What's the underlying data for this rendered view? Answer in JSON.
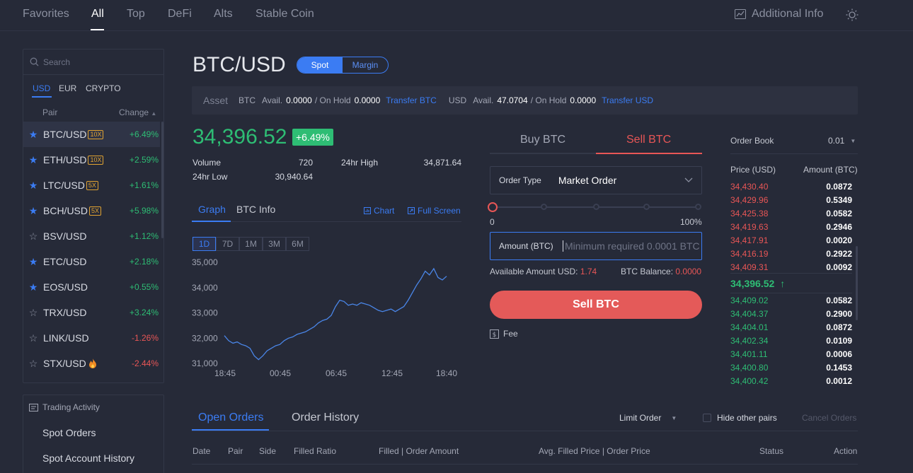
{
  "topnav": {
    "tabs": [
      "Favorites",
      "All",
      "Top",
      "DeFi",
      "Alts",
      "Stable Coin"
    ],
    "active": "All",
    "additional_info": "Additional Info"
  },
  "sidebar": {
    "search_placeholder": "Search",
    "currencies": [
      "USD",
      "EUR",
      "CRYPTO"
    ],
    "active_currency": "USD",
    "col_pair": "Pair",
    "col_change": "Change",
    "pairs": [
      {
        "name": "BTC/USD",
        "leverage": "10X",
        "change": "+6.49%",
        "starred": true
      },
      {
        "name": "ETH/USD",
        "leverage": "10X",
        "change": "+2.59%",
        "starred": true
      },
      {
        "name": "LTC/USD",
        "leverage": "5X",
        "change": "+1.61%",
        "starred": true
      },
      {
        "name": "BCH/USD",
        "leverage": "5X",
        "change": "+5.98%",
        "starred": true
      },
      {
        "name": "BSV/USD",
        "leverage": "",
        "change": "+1.12%",
        "starred": false
      },
      {
        "name": "ETC/USD",
        "leverage": "",
        "change": "+2.18%",
        "starred": true
      },
      {
        "name": "EOS/USD",
        "leverage": "",
        "change": "+0.55%",
        "starred": true
      },
      {
        "name": "TRX/USD",
        "leverage": "",
        "change": "+3.24%",
        "starred": false
      },
      {
        "name": "LINK/USD",
        "leverage": "",
        "change": "-1.26%",
        "starred": false
      },
      {
        "name": "STX/USD",
        "leverage": "",
        "change": "-2.44%",
        "starred": false
      }
    ]
  },
  "activity": {
    "title": "Trading Activity",
    "items": [
      "Spot Orders",
      "Spot Account History"
    ]
  },
  "header": {
    "pair": "BTC/USD",
    "spot": "Spot",
    "margin": "Margin"
  },
  "assets": {
    "label": "Asset",
    "btc_cur": "BTC",
    "btc_avail_label": "Avail.",
    "btc_avail": "0.0000",
    "btc_hold_label": "/ On Hold",
    "btc_hold": "0.0000",
    "transfer_btc": "Transfer BTC",
    "usd_cur": "USD",
    "usd_avail_label": "Avail.",
    "usd_avail": "47.0704",
    "usd_hold_label": "/ On Hold",
    "usd_hold": "0.0000",
    "transfer_usd": "Transfer USD"
  },
  "ticker": {
    "price": "34,396.52",
    "change": "+6.49%",
    "volume_label": "Volume",
    "volume": "720",
    "high_label": "24hr High",
    "high": "34,871.64",
    "low_label": "24hr Low",
    "low": "30,940.64"
  },
  "graph": {
    "tab_graph": "Graph",
    "tab_info": "BTC Info",
    "chart_link": "Chart",
    "fullscreen_link": "Full Screen",
    "ranges": [
      "1D",
      "7D",
      "1M",
      "3M",
      "6M"
    ],
    "active_range": "1D"
  },
  "chart_data": {
    "type": "line",
    "title": "",
    "xlabel": "",
    "ylabel": "",
    "x_ticks": [
      "18:45",
      "00:45",
      "06:45",
      "12:45",
      "18:40"
    ],
    "y_ticks": [
      "35,000",
      "34,000",
      "33,000",
      "32,000",
      "31,000"
    ],
    "ylim": [
      31000,
      35000
    ],
    "color": "#4a86e8",
    "series": [
      {
        "values": [
          32100,
          31900,
          31800,
          31850,
          31750,
          31700,
          31600,
          31300,
          31150,
          31300,
          31500,
          31600,
          31700,
          31750,
          31900,
          32000,
          32050,
          32150,
          32200,
          32250,
          32350,
          32450,
          32600,
          32700,
          32750,
          32900,
          33250,
          33500,
          33450,
          33300,
          33350,
          33300,
          33400,
          33350,
          33300,
          33200,
          33100,
          33050,
          33100,
          33150,
          33050,
          33150,
          33250,
          33500,
          33800,
          34100,
          34350,
          34650,
          34500,
          34750,
          34400,
          34300,
          34450
        ]
      }
    ]
  },
  "order_form": {
    "buy_tab": "Buy BTC",
    "sell_tab": "Sell BTC",
    "active_tab": "Sell BTC",
    "order_type_label": "Order Type",
    "order_type_value": "Market Order",
    "slider_min": "0",
    "slider_max": "100%",
    "slider_value": 0,
    "amount_label": "Amount (BTC)",
    "amount_placeholder": "Minimum required 0.0001 BTC",
    "avail_usd_label": "Available Amount USD:",
    "avail_usd": "1.74",
    "btc_balance_label": "BTC Balance:",
    "btc_balance": "0.0000",
    "submit": "Sell BTC",
    "fee": "Fee"
  },
  "order_book": {
    "title": "Order Book",
    "precision": "0.01",
    "col_price": "Price (USD)",
    "col_amount": "Amount (BTC)",
    "asks": [
      {
        "price": "34,430.40",
        "amount": "0.0872"
      },
      {
        "price": "34,429.96",
        "amount": "0.5349"
      },
      {
        "price": "34,425.38",
        "amount": "0.0582"
      },
      {
        "price": "34,419.63",
        "amount": "0.2946"
      },
      {
        "price": "34,417.91",
        "amount": "0.0020"
      },
      {
        "price": "34,416.19",
        "amount": "0.2922"
      },
      {
        "price": "34,409.31",
        "amount": "0.0092"
      }
    ],
    "last_price": "34,396.52",
    "bids": [
      {
        "price": "34,409.02",
        "amount": "0.0582"
      },
      {
        "price": "34,404.37",
        "amount": "0.2900"
      },
      {
        "price": "34,404.01",
        "amount": "0.0872"
      },
      {
        "price": "34,402.34",
        "amount": "0.0109"
      },
      {
        "price": "34,401.11",
        "amount": "0.0006"
      },
      {
        "price": "34,400.80",
        "amount": "0.1453"
      },
      {
        "price": "34,400.42",
        "amount": "0.0012"
      }
    ]
  },
  "orders": {
    "tab_open": "Open Orders",
    "tab_history": "Order History",
    "filter": "Limit Order",
    "hide_pairs": "Hide other pairs",
    "cancel": "Cancel Orders",
    "columns": [
      "Date",
      "Pair",
      "Side",
      "Filled Ratio",
      "Filled | Order Amount",
      "Avg. Filled Price | Order Price",
      "Status",
      "Action"
    ]
  }
}
